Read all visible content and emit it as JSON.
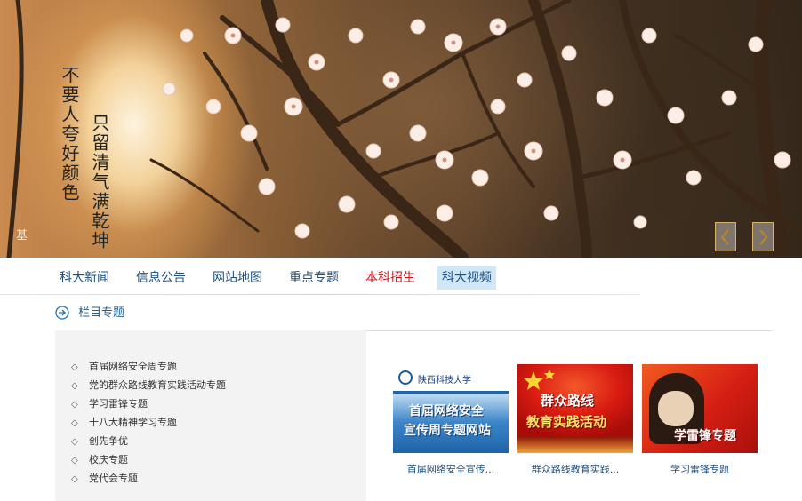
{
  "banner": {
    "poem_line1": "不要人夸好颜色",
    "poem_line2": "只留清气满乾坤",
    "prev_label": "previous slide",
    "next_label": "next slide",
    "stray_text": "基"
  },
  "nav": {
    "items": [
      {
        "label": "科大新闻"
      },
      {
        "label": "信息公告"
      },
      {
        "label": "网站地图"
      },
      {
        "label": "重点专题"
      },
      {
        "label": "本科招生"
      },
      {
        "label": "科大视频"
      }
    ]
  },
  "section": {
    "title": "栏目专题"
  },
  "topics": {
    "items": [
      {
        "label": "首届网络安全周专题"
      },
      {
        "label": "党的群众路线教育实践活动专题"
      },
      {
        "label": "学习雷锋专题"
      },
      {
        "label": "十八大精神学习专题"
      },
      {
        "label": "创先争优"
      },
      {
        "label": "校庆专题"
      },
      {
        "label": "党代会专题"
      }
    ],
    "bullet": "◇"
  },
  "cards": [
    {
      "caption": "首届网络安全宣传...",
      "thumb_school": "陕西科技大学",
      "thumb_line1": "首届网络安全",
      "thumb_line2": "宣传周专题网站"
    },
    {
      "caption": "群众路线教育实践...",
      "thumb_line1": "群众路线",
      "thumb_line2": "教育实践活动"
    },
    {
      "caption": "学习雷锋专题",
      "thumb_line1": "学雷锋专题"
    }
  ],
  "colors": {
    "nav_text": "#1f4e7a",
    "nav_highlight": "#c8161d",
    "nav_active_bg": "#cfe7f7",
    "section_title": "#1f5f95",
    "panel_bg": "#f3f3f3"
  },
  "icons": {
    "section": "circle-arrow-right-icon",
    "prev": "chevron-left-icon",
    "next": "chevron-right-icon"
  }
}
